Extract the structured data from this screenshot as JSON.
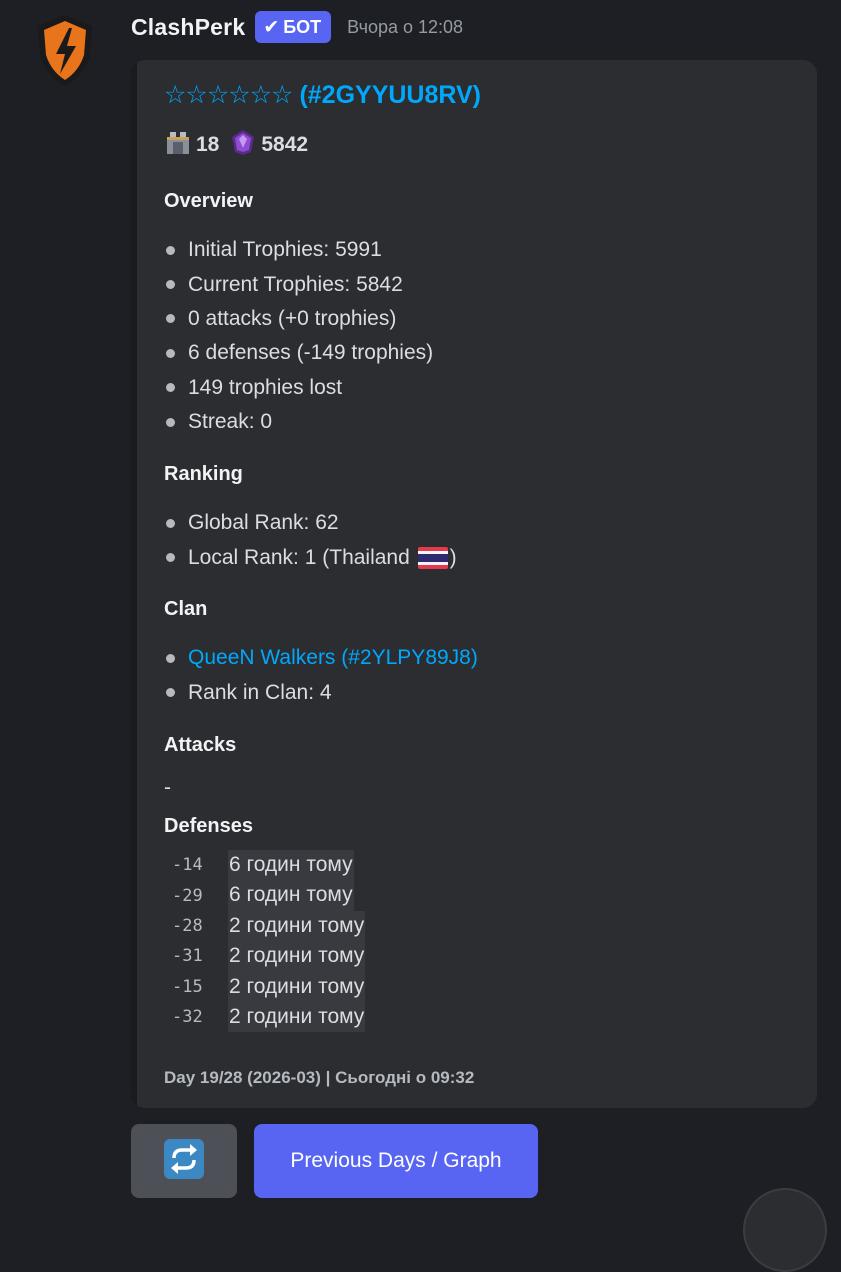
{
  "message": {
    "author": "ClashPerk",
    "bot_badge": "БОТ",
    "timestamp": "Вчора о 12:08"
  },
  "embed": {
    "title_stars": "☆☆☆☆☆☆",
    "title_tag": "(#2GYYUU8RV)",
    "stats": {
      "level": "18",
      "trophies": "5842"
    },
    "overview": {
      "heading": "Overview",
      "items": [
        "Initial Trophies: 5991",
        "Current Trophies: 5842",
        "0 attacks (+0 trophies)",
        "6 defenses (-149 trophies)",
        "149 trophies lost",
        "Streak: 0"
      ]
    },
    "ranking": {
      "heading": "Ranking",
      "global": "Global Rank: 62",
      "local_prefix": "Local Rank: 1 (Thailand ",
      "local_suffix": ")"
    },
    "clan": {
      "heading": "Clan",
      "link": "QueeN Walkers (#2YLPY89J8)",
      "rank": "Rank in Clan: 4"
    },
    "attacks": {
      "heading": "Attacks",
      "value": "-"
    },
    "defenses": {
      "heading": "Defenses",
      "rows": [
        {
          "value": "-14",
          "time": "6 годин тому"
        },
        {
          "value": "-29",
          "time": "6 годин тому"
        },
        {
          "value": "-28",
          "time": "2 години тому"
        },
        {
          "value": "-31",
          "time": "2 години тому"
        },
        {
          "value": "-15",
          "time": "2 години тому"
        },
        {
          "value": "-32",
          "time": "2 години тому"
        }
      ]
    },
    "footer": "Day 19/28 (2026-03) | Сьогодні о 09:32"
  },
  "buttons": {
    "refresh_icon": "refresh-icon",
    "previous": "Previous Days / Graph"
  },
  "colors": {
    "accent": "#5865f2",
    "link": "#00a8fc",
    "background": "#1e1f24",
    "embed": "#2b2d31"
  }
}
